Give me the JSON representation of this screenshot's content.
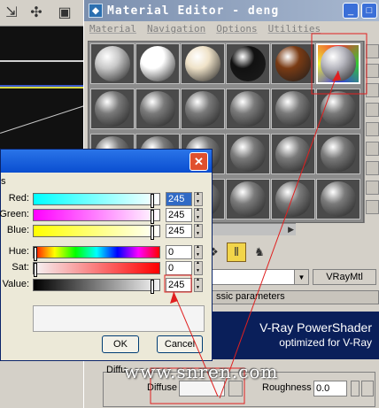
{
  "material_editor": {
    "title": "Material Editor - deng",
    "menus": [
      "Material",
      "Navigation",
      "Options",
      "Utilities"
    ],
    "material_name_value": "",
    "material_type": "VRayMtl",
    "rollout_title": "ssic parameters",
    "banner": {
      "line1": "V-Ray PowerShader",
      "line2": "optimized for V-Ray"
    },
    "diffuse": {
      "group_label": "Diffu",
      "label": "Diffuse",
      "color": "#f5f5f5"
    },
    "roughness": {
      "label": "Roughness",
      "value": "0.0"
    },
    "slots": [
      {
        "row": 0,
        "col": 0,
        "style": "#c8c8c8"
      },
      {
        "row": 0,
        "col": 1,
        "style": "#ffffff"
      },
      {
        "row": 0,
        "col": 2,
        "style": "#efe2c8"
      },
      {
        "row": 0,
        "col": 3,
        "style": "#111111"
      },
      {
        "row": 0,
        "col": 4,
        "style": "#7a3b14"
      },
      {
        "row": 0,
        "col": 5,
        "style": "#b8b8c0",
        "selected": true
      }
    ]
  },
  "color_dialog": {
    "section_label": "s",
    "rows": [
      {
        "label": "Red:",
        "value": "245",
        "highlight": true,
        "level": 0.96,
        "gradient": "linear-gradient(90deg,#00ffff,#ffffff)"
      },
      {
        "label": "Green:",
        "value": "245",
        "highlight": false,
        "level": 0.96,
        "gradient": "linear-gradient(90deg,#ff00ff,#ffffff)"
      },
      {
        "label": "Blue:",
        "value": "245",
        "highlight": false,
        "level": 0.96,
        "gradient": "linear-gradient(90deg,#ffff00,#ffffff)"
      },
      {
        "label": "Hue:",
        "value": "0",
        "highlight": false,
        "level": 0.0,
        "gradient": "linear-gradient(90deg,#ff0000,#ffff00,#00ff00,#00ffff,#0000ff,#ff00ff,#ff0000)"
      },
      {
        "label": "Sat:",
        "value": "0",
        "highlight": false,
        "level": 0.0,
        "gradient": "linear-gradient(90deg,#f5f5f5,#ff0000)"
      },
      {
        "label": "Value:",
        "value": "245",
        "highlight": false,
        "level": 0.96,
        "gradient": "linear-gradient(90deg,#000000,#f5f5f5)"
      }
    ],
    "ok_label": "OK",
    "cancel_label": "Cancel",
    "close_icon": "close-icon"
  },
  "watermark": "www.snren.com",
  "colors": {
    "annotation_red": "#e02020",
    "banner_bg": "#0a1f5a",
    "titlebar_blue": "#0a4ed0"
  }
}
